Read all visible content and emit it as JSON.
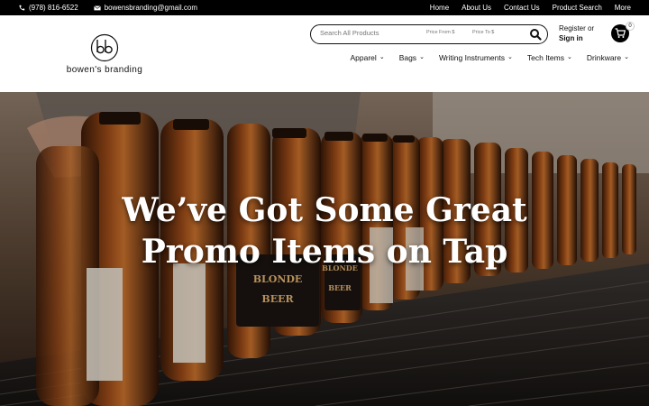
{
  "topbar": {
    "phone": "(978) 816-6522",
    "email": "bowensbranding@gmail.com",
    "links": [
      "Home",
      "About Us",
      "Contact Us",
      "Product Search",
      "More"
    ]
  },
  "header": {
    "logo_text": "bowen's branding",
    "search": {
      "placeholder": "Search All Products",
      "price_from": "Price From $",
      "price_to": "Price To $"
    },
    "account": {
      "register": "Register or",
      "signin": "Sign in"
    },
    "cart_count": "0",
    "nav": [
      "Apparel",
      "Bags",
      "Writing Instruments",
      "Tech Items",
      "Drinkware"
    ]
  },
  "hero": {
    "headline_line1": "We’ve Got Some Great",
    "headline_line2": "Promo Items on Tap",
    "bottle_label_1": "BLONDE",
    "bottle_label_2": "BEER"
  },
  "colors": {
    "topbar": "#000000",
    "accent": "#111111",
    "hero_bg": "#3a2a20"
  }
}
